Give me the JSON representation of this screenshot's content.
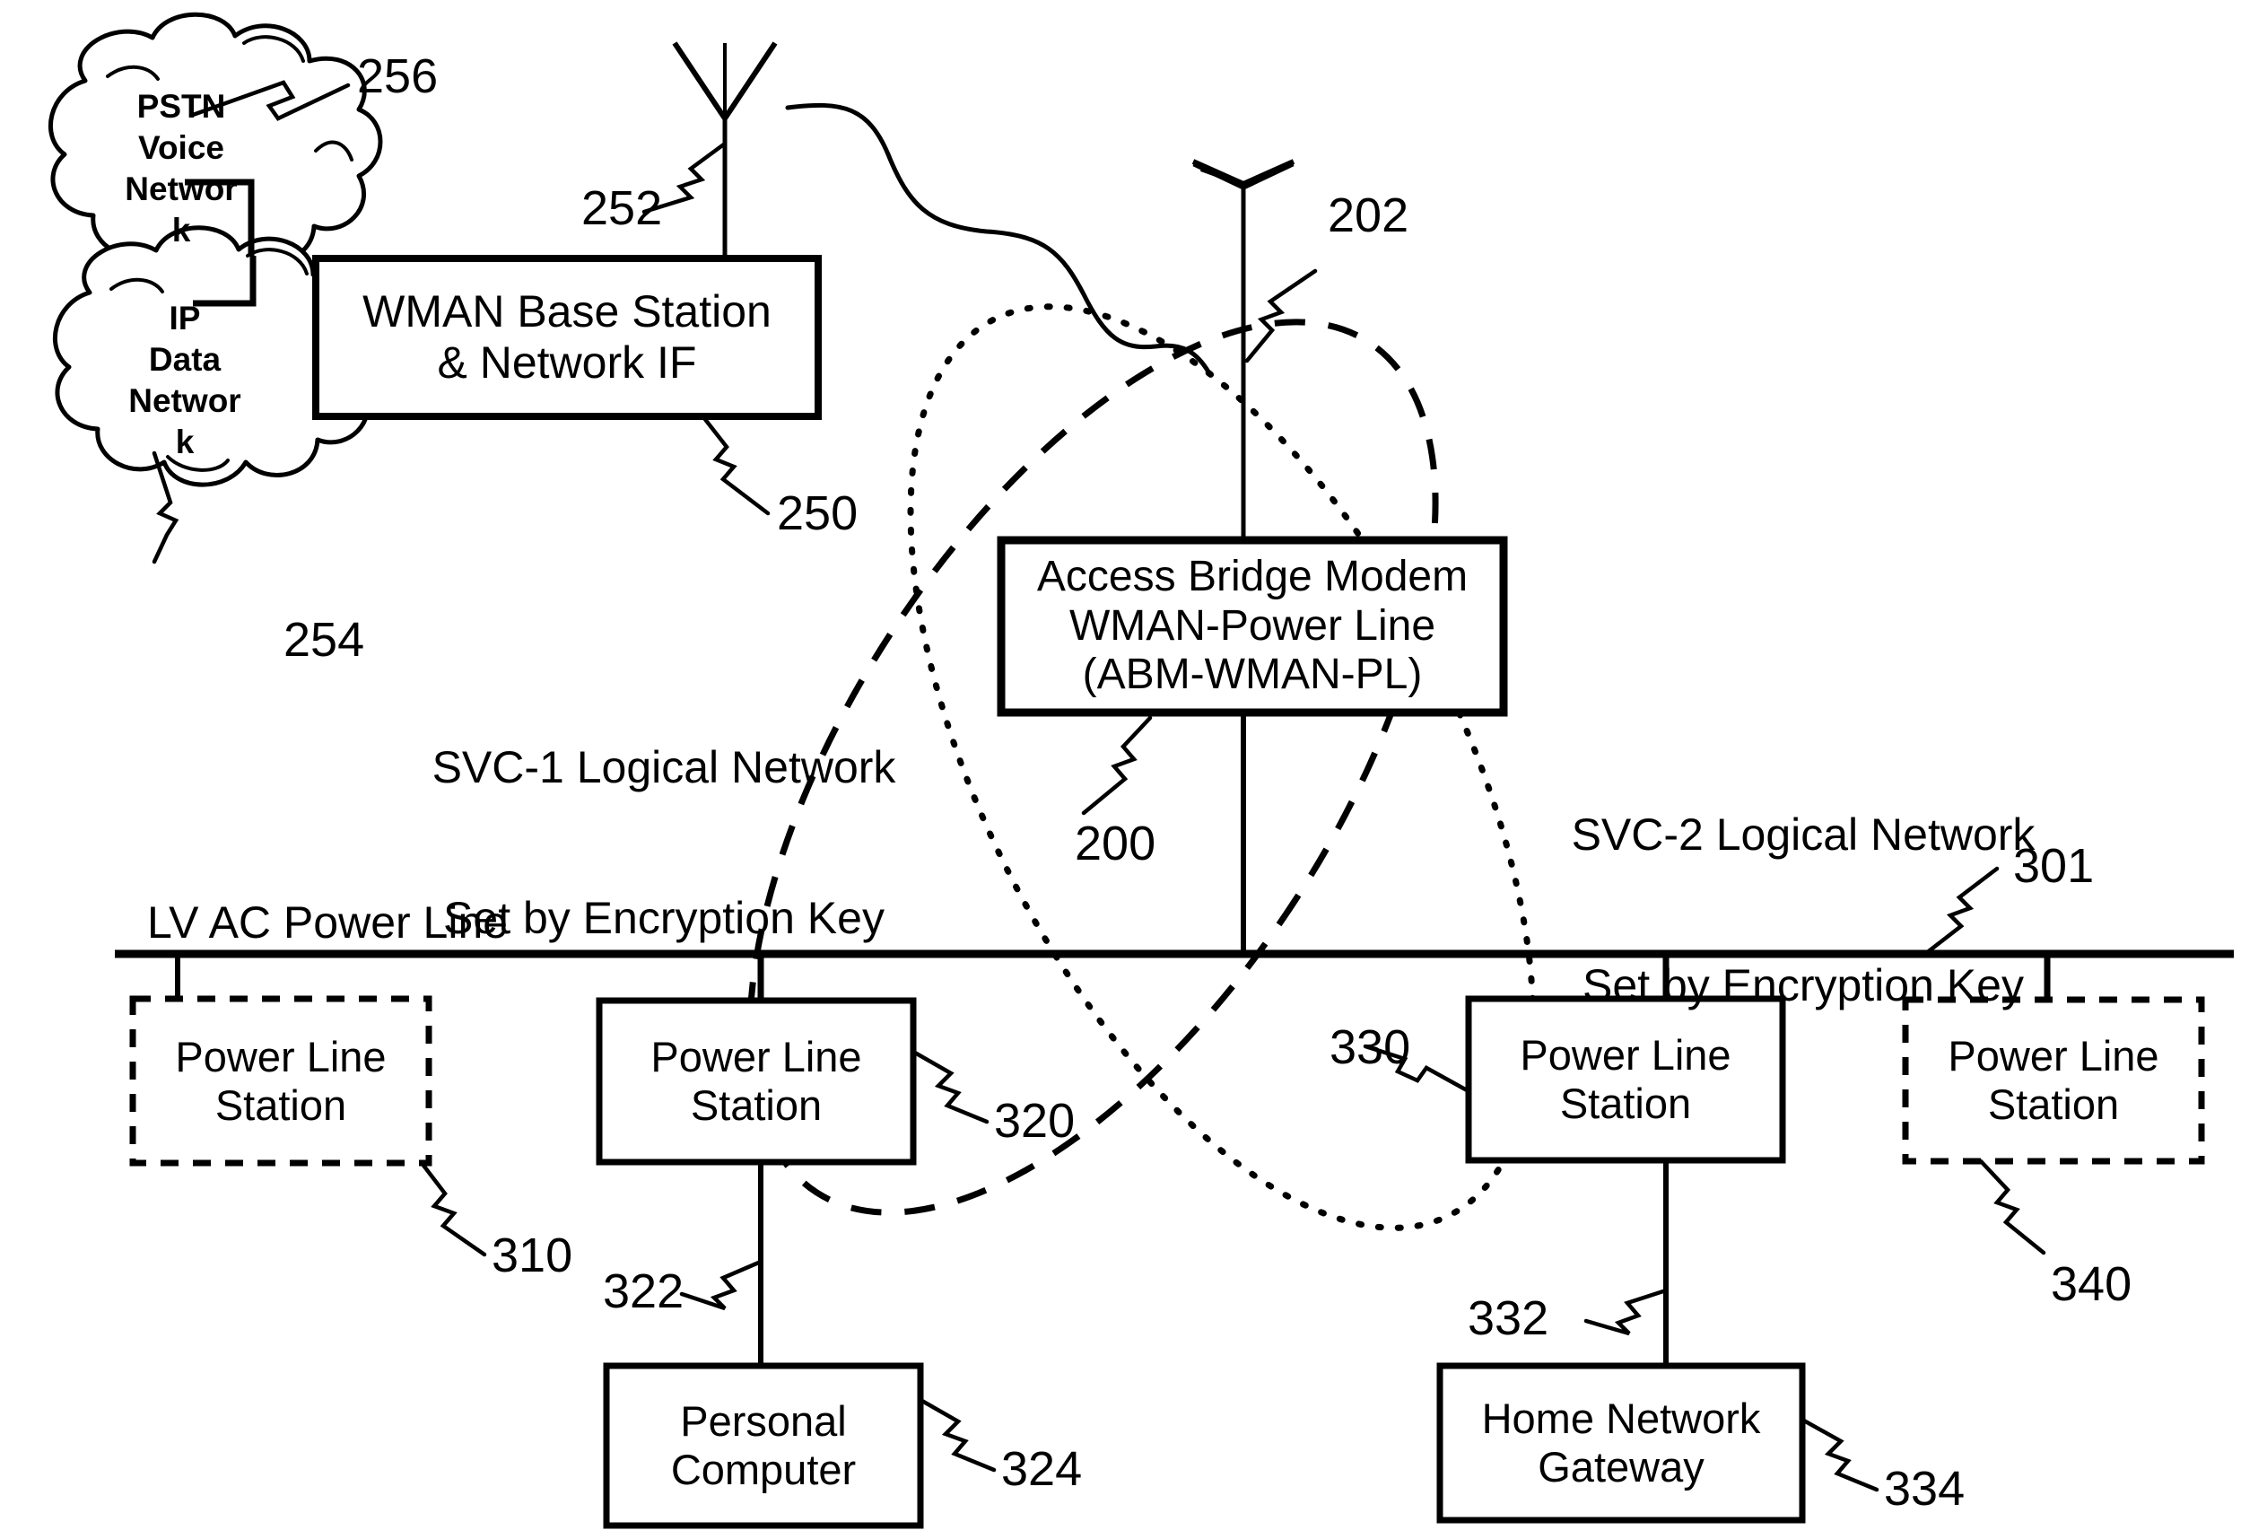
{
  "figure": {
    "background": "#ffffff",
    "stroke": "#000000"
  },
  "clouds": [
    {
      "id": "pstn-voice-network",
      "lines": [
        "PSTN",
        "Voice",
        "Networ",
        "k"
      ],
      "ref": "256"
    },
    {
      "id": "ip-data-network",
      "lines": [
        "IP",
        "Data",
        "Networ",
        "k"
      ],
      "ref": "254"
    }
  ],
  "boxes": {
    "wman_base_station": {
      "lines": [
        "WMAN Base Station",
        "& Network IF"
      ],
      "ref": "250",
      "border": "solid"
    },
    "access_bridge_modem": {
      "lines": [
        "Access Bridge Modem",
        "WMAN-Power Line",
        "(ABM-WMAN-PL)"
      ],
      "ref": "200",
      "border": "solid"
    },
    "power_line_station_1": {
      "lines": [
        "Power Line",
        "Station"
      ],
      "ref": "310",
      "border": "dashed"
    },
    "power_line_station_2": {
      "lines": [
        "Power Line",
        "Station"
      ],
      "ref": "320",
      "border": "solid"
    },
    "power_line_station_3": {
      "lines": [
        "Power Line",
        "Station"
      ],
      "ref": "330",
      "border": "solid"
    },
    "power_line_station_4": {
      "lines": [
        "Power Line",
        "Station"
      ],
      "ref": "340",
      "border": "dashed"
    },
    "personal_computer": {
      "lines": [
        "Personal",
        "Computer"
      ],
      "ref": "324",
      "border": "solid"
    },
    "home_network_gateway": {
      "lines": [
        "Home Network",
        "Gateway"
      ],
      "ref": "334",
      "border": "solid"
    }
  },
  "antennas": {
    "base_station_antenna": {
      "ref": "252"
    },
    "abm_antenna": {
      "ref": "202"
    }
  },
  "annotations": {
    "svc1_label": {
      "lines": [
        "SVC-1 Logical Network",
        "Set by Encryption Key"
      ],
      "style": "dashed-ellipse"
    },
    "svc2_label": {
      "lines": [
        "SVC-2 Logical Network",
        "Set by Encryption Key"
      ],
      "style": "dotted-ellipse"
    },
    "power_line_label": {
      "text": "LV AC Power Line",
      "ref": "301"
    }
  },
  "connectors": {
    "pc_drop_ref": "322",
    "gateway_drop_ref": "332"
  },
  "reference_numerals": [
    "200",
    "202",
    "250",
    "252",
    "254",
    "256",
    "301",
    "310",
    "320",
    "322",
    "324",
    "330",
    "332",
    "334",
    "340"
  ]
}
